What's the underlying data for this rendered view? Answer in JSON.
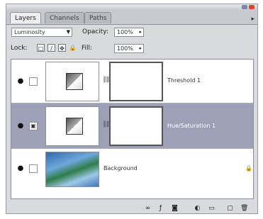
{
  "window": {
    "title_buttons": [
      "minimize",
      "close"
    ],
    "colors": {
      "close": "#d9442b",
      "minimize": "#7a86a8"
    }
  },
  "tabs": [
    {
      "label": "Layers",
      "active": true
    },
    {
      "label": "Channels",
      "active": false
    },
    {
      "label": "Paths",
      "active": false
    }
  ],
  "panel_menu_icon": "triangle-right-icon",
  "blend_mode": {
    "value": "Luminosity"
  },
  "opacity": {
    "label": "Opacity:",
    "value": "100%"
  },
  "lock": {
    "label": "Lock:",
    "icons": [
      "transparency-lock-icon",
      "brush-lock-icon",
      "move-lock-icon",
      "padlock-icon"
    ]
  },
  "fill": {
    "label": "Fill:",
    "value": "100%"
  },
  "layers": [
    {
      "name": "Threshold 1",
      "kind": "adjustment",
      "visible": true,
      "selected": false
    },
    {
      "name": "Hue/Saturation 1",
      "kind": "adjustment",
      "visible": true,
      "selected": true
    },
    {
      "name": "Background",
      "kind": "image",
      "visible": true,
      "selected": false,
      "locked": true
    }
  ],
  "footer_icons": [
    "link-layers-icon",
    "layer-style-icon",
    "add-mask-icon",
    "adjustment-layer-icon",
    "new-group-icon",
    "new-layer-icon",
    "trash-icon"
  ],
  "colors": {
    "panel_bg": "#d9dadd",
    "selected_row": "#9ea0b8",
    "list_bg": "#ffffff"
  }
}
